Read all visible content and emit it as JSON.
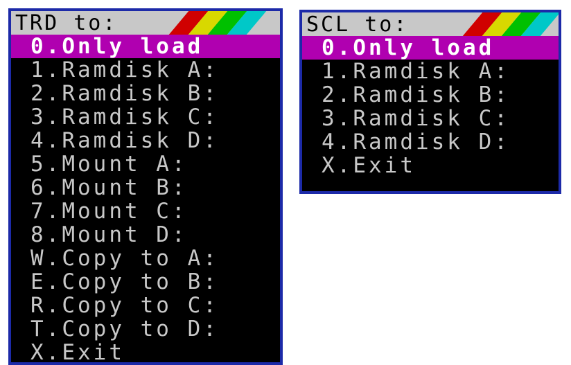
{
  "colors": {
    "frame_border": "#1c2aa8",
    "title_background": "#c8c8c8",
    "menu_background": "#000000",
    "menu_text": "#c8c8c8",
    "selected_background": "#b000b0",
    "selected_text": "#ffffff",
    "stripes": [
      "#d00000",
      "#d8d800",
      "#00c000",
      "#00c8c8"
    ]
  },
  "trd_menu": {
    "title": "TRD to:",
    "selected_index": 0,
    "items": [
      {
        "label": "0.Only load"
      },
      {
        "label": "1.Ramdisk A:"
      },
      {
        "label": "2.Ramdisk B:"
      },
      {
        "label": "3.Ramdisk C:"
      },
      {
        "label": "4.Ramdisk D:"
      },
      {
        "label": "5.Mount A:"
      },
      {
        "label": "6.Mount B:"
      },
      {
        "label": "7.Mount C:"
      },
      {
        "label": "8.Mount D:"
      },
      {
        "label": "W.Copy to A:"
      },
      {
        "label": "E.Copy to B:"
      },
      {
        "label": "R.Copy to C:"
      },
      {
        "label": "T.Copy to D:"
      },
      {
        "label": "X.Exit"
      }
    ]
  },
  "scl_menu": {
    "title": "SCL to:",
    "selected_index": 0,
    "items": [
      {
        "label": "0.Only load"
      },
      {
        "label": "1.Ramdisk A:"
      },
      {
        "label": "2.Ramdisk B:"
      },
      {
        "label": "3.Ramdisk C:"
      },
      {
        "label": "4.Ramdisk D:"
      },
      {
        "label": "X.Exit"
      }
    ]
  }
}
